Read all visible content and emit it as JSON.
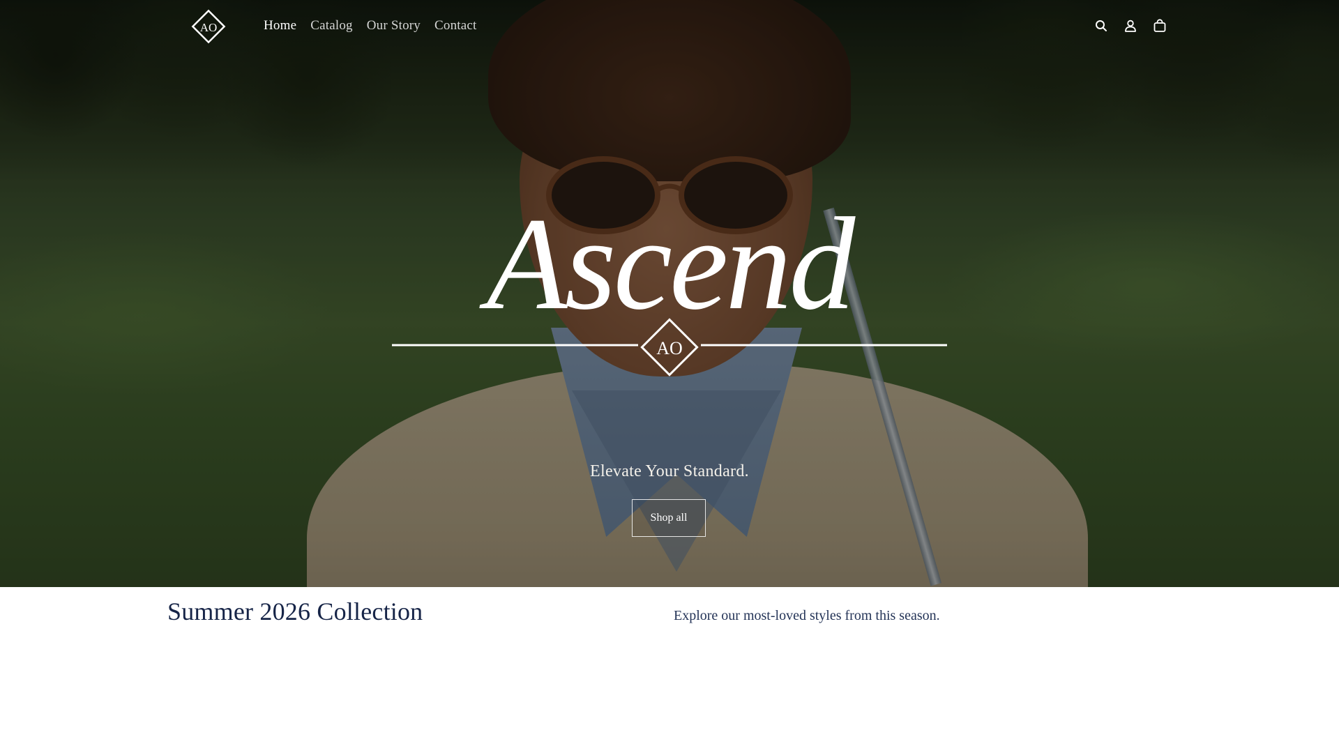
{
  "brand": {
    "name": "Ascend",
    "monogram": "AO"
  },
  "header": {
    "nav": [
      {
        "label": "Home",
        "active": true
      },
      {
        "label": "Catalog",
        "active": false
      },
      {
        "label": "Our Story",
        "active": false
      },
      {
        "label": "Contact",
        "active": false
      }
    ],
    "icons": [
      "search-icon",
      "account-icon",
      "cart-icon"
    ]
  },
  "hero": {
    "tagline": "Elevate Your Standard.",
    "cta_label": "Shop all"
  },
  "collection": {
    "title": "Summer 2026 Collection",
    "description": "Explore our most-loved styles from this season."
  },
  "colors": {
    "navy": "#162447",
    "white": "#ffffff",
    "overlay": "#000000"
  }
}
